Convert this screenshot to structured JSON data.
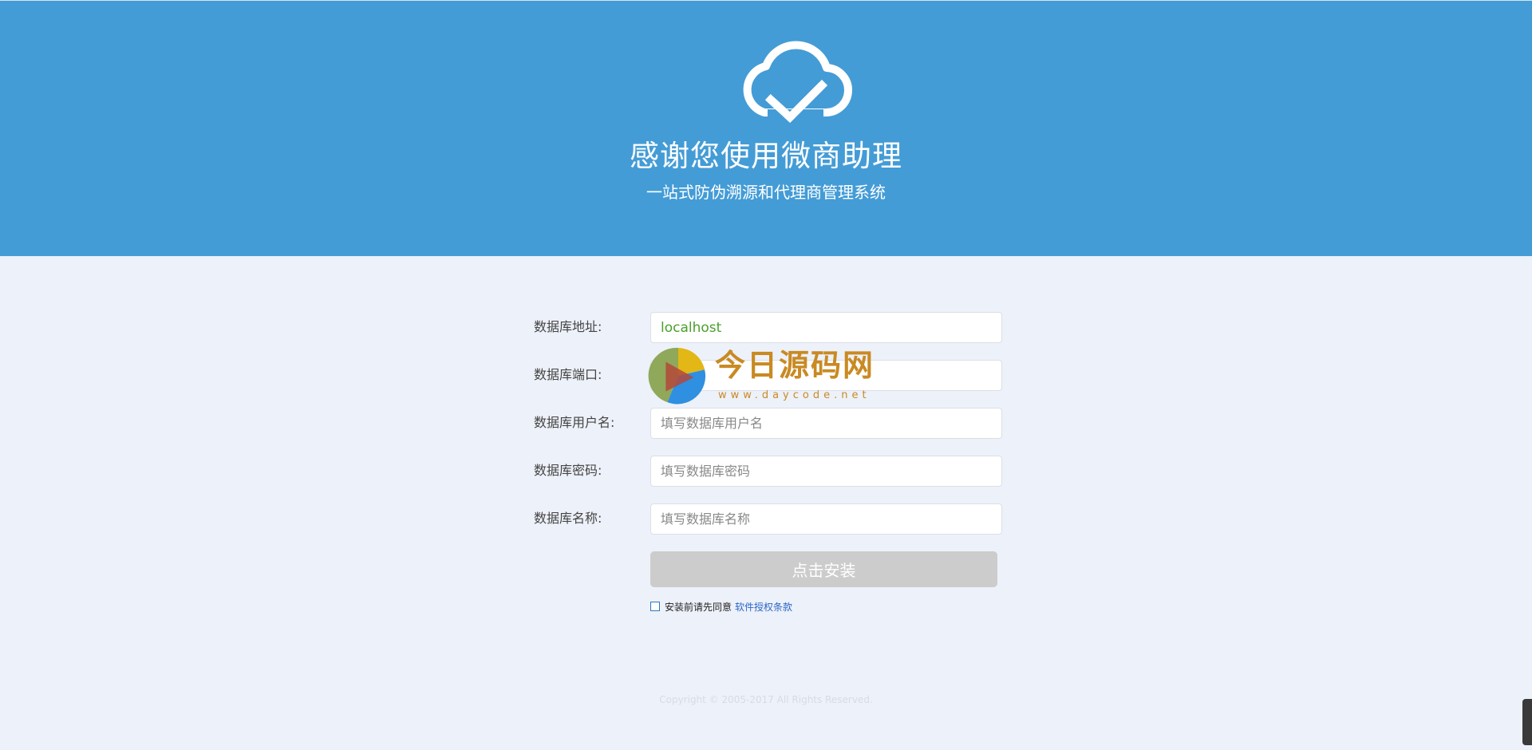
{
  "header": {
    "title": "感谢您使用微商助理",
    "subtitle": "一站式防伪溯源和代理商管理系统"
  },
  "form": {
    "host": {
      "label": "数据库地址:",
      "value": "localhost",
      "placeholder": ""
    },
    "port": {
      "label": "数据库端口:",
      "value": "3306",
      "placeholder": ""
    },
    "user": {
      "label": "数据库用户名:",
      "value": "",
      "placeholder": "填写数据库用户名"
    },
    "password": {
      "label": "数据库密码:",
      "value": "",
      "placeholder": "填写数据库密码"
    },
    "name": {
      "label": "数据库名称:",
      "value": "",
      "placeholder": "填写数据库名称"
    },
    "submit_label": "点击安装",
    "agree_text": "安装前请先同意",
    "agree_link": "软件授权条款",
    "agree_checked": false
  },
  "watermark": {
    "text": "今日源码网",
    "url": "www.daycode.net"
  },
  "footer": {
    "copyright": "Copyright © 2005-2017 All Rights Reserved."
  },
  "colors": {
    "header_bg": "#449cd6",
    "page_bg": "#edf1f9",
    "button_disabled": "#cccccc",
    "link": "#2a66c9",
    "host_value": "#4aa02c"
  },
  "icons": {
    "header": "cloud-check-icon",
    "watermark": "play-logo-icon"
  }
}
